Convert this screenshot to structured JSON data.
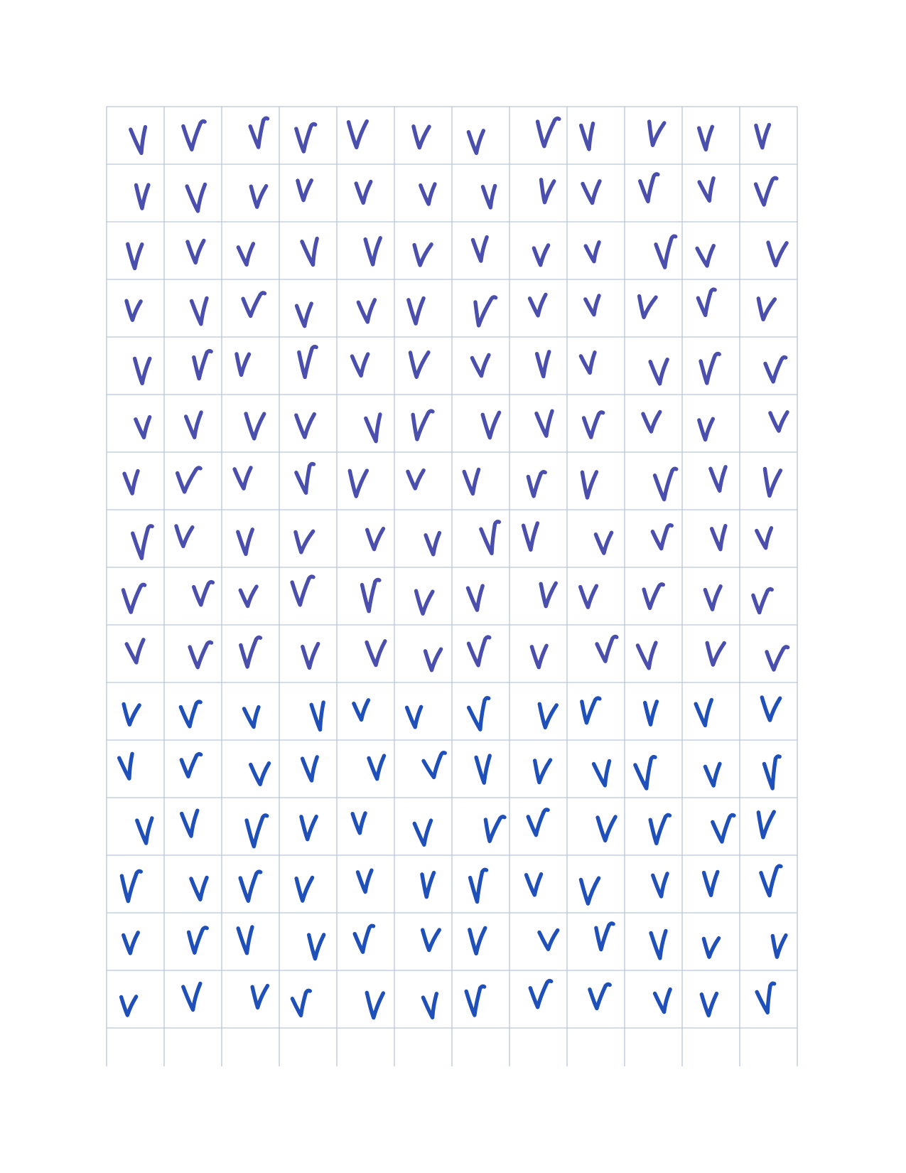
{
  "worksheet": {
    "grid": {
      "columns": 12,
      "drawn_rows": 17,
      "filled_rows": 16,
      "line_color": "#b9c6d9"
    },
    "mark": {
      "symbol": "check-mark-icon",
      "text": "V",
      "count_per_row": 12
    },
    "ink_colors": {
      "rows_1_to_10": "#4a4fae",
      "rows_11_to_16": "#1f4fb8"
    }
  }
}
